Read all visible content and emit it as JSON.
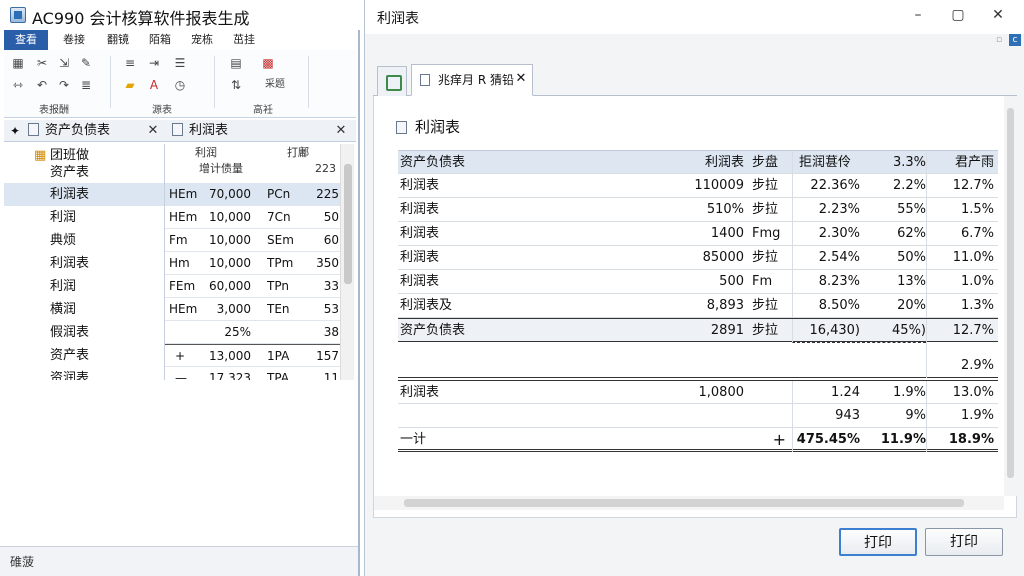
{
  "left_window": {
    "title": "AC990 会计核算软件报表生成",
    "menu": [
      {
        "label": "查看",
        "active": true
      },
      {
        "label": "卷接",
        "active": false
      },
      {
        "label": "翻镜",
        "active": false
      },
      {
        "label": "陌箱",
        "active": false
      },
      {
        "label": "宠栋",
        "active": false
      },
      {
        "label": "茁挂",
        "active": false
      }
    ],
    "ribbon_groups": [
      "表报酬",
      "源表",
      "高衽"
    ],
    "ribbon_extra": "采题",
    "pane_headers": {
      "tree": "资产负债表",
      "grid": "利润表"
    },
    "tree": [
      {
        "label": "团班做",
        "selected": false
      },
      {
        "label": "资产表",
        "selected": false
      },
      {
        "label": "利润表",
        "selected": true
      },
      {
        "label": "利润",
        "selected": false
      },
      {
        "label": "典烦",
        "selected": false
      },
      {
        "label": "利润表",
        "selected": false
      },
      {
        "label": "利润",
        "selected": false
      },
      {
        "label": "横润",
        "selected": false
      },
      {
        "label": "假润表",
        "selected": false
      },
      {
        "label": "资产表",
        "selected": false
      },
      {
        "label": "资润表",
        "selected": false
      }
    ],
    "grid_headers": {
      "col2": "利润",
      "col2_sub": "增计债量",
      "col3": "打鄘",
      "col4": "223"
    },
    "grid_rows": [
      {
        "c1": "HEm",
        "c2": "70,000",
        "c3": "PCn",
        "c4": "225",
        "selected": true
      },
      {
        "c1": "HEm",
        "c2": "10,000",
        "c3": "7Cn",
        "c4": "50",
        "selected": false
      },
      {
        "c1": "Fm",
        "c2": "10,000",
        "c3": "SEm",
        "c4": "60",
        "selected": false
      },
      {
        "c1": "Hm",
        "c2": "10,000",
        "c3": "TPm",
        "c4": "350",
        "selected": false
      },
      {
        "c1": "FEm",
        "c2": "60,000",
        "c3": "TPn",
        "c4": "33",
        "selected": false
      },
      {
        "c1": "HEm",
        "c2": "3,000",
        "c3": "TEn",
        "c4": "53",
        "selected": false
      },
      {
        "c1": "",
        "c2": "25%",
        "c3": "",
        "c4": "38",
        "selected": false
      },
      {
        "c1": "+",
        "c2": "13,000",
        "c3": "1PA",
        "c4": "157",
        "selected": false
      },
      {
        "c1": "—",
        "c2": "17,323",
        "c3": "TPA",
        "c4": "11",
        "selected": false
      }
    ],
    "status": "碓菠"
  },
  "right_window": {
    "title": "利润表",
    "tab_label": "兆痒月 R 猜铅",
    "doc_title": "利润表",
    "report_headers": [
      "资产负债表",
      "利润表",
      "步盘",
      "拒润葚伶",
      "3.3%",
      "君产雨"
    ],
    "report_rows": [
      {
        "name": "利润表",
        "c1": "110009",
        "c2": "步拉",
        "c3": "22.36%",
        "c4": "2.2%",
        "c5": "12.7%"
      },
      {
        "name": "利润表",
        "c1": "510%",
        "c2": "步拉",
        "c3": "2.23%",
        "c4": "55%",
        "c5": "1.5%"
      },
      {
        "name": "利润表",
        "c1": "1400",
        "c2": "Fmg",
        "c3": "2.30%",
        "c4": "62%",
        "c5": "6.7%"
      },
      {
        "name": "利润表",
        "c1": "85000",
        "c2": "步拉",
        "c3": "2.54%",
        "c4": "50%",
        "c5": "11.0%"
      },
      {
        "name": "利润表",
        "c1": "500",
        "c2": "Fm",
        "c3": "8.23%",
        "c4": "13%",
        "c5": "1.0%"
      },
      {
        "name": "利润表及",
        "c1": "8,893",
        "c2": "步拉",
        "c3": "8.50%",
        "c4": "20%",
        "c5": "1.3%"
      }
    ],
    "subtotal_row": {
      "name": "资产负债表",
      "c1": "2891",
      "c2": "步拉",
      "c3": "16,430)",
      "c4": "45%)",
      "c5": "12.7%"
    },
    "blank_row": {
      "c5": "2.9%"
    },
    "second_row": {
      "name": "利润表",
      "c1": "1,0800",
      "c3": "1.24",
      "c4": "1.9%",
      "c5": "13.0%"
    },
    "third_row": {
      "c3": "943",
      "c4": "9%",
      "c5": "1.9%"
    },
    "total_row": {
      "name": "一计",
      "c2": "+",
      "c3": "475.45%",
      "c4": "11.9%",
      "c5": "18.9%"
    },
    "buttons": {
      "print_primary": "打印",
      "print_secondary": "打印"
    }
  }
}
